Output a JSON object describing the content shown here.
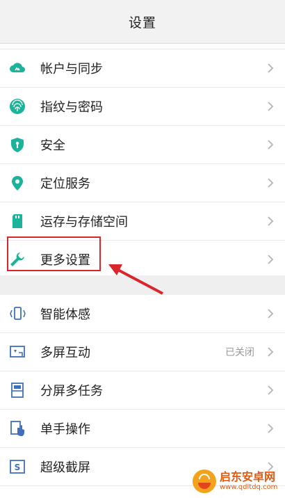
{
  "header": {
    "title": "设置"
  },
  "group1": [
    {
      "id": "account-sync",
      "label": "帐户与同步",
      "icon": "cloud-sync-icon"
    },
    {
      "id": "fingerprint-password",
      "label": "指纹与密码",
      "icon": "fingerprint-icon"
    },
    {
      "id": "security",
      "label": "安全",
      "icon": "shield-icon"
    },
    {
      "id": "location",
      "label": "定位服务",
      "icon": "location-pin-icon"
    },
    {
      "id": "storage",
      "label": "运存与存储空间",
      "icon": "sd-card-icon"
    },
    {
      "id": "more-settings",
      "label": "更多设置",
      "icon": "wrench-icon"
    }
  ],
  "group2": [
    {
      "id": "smart-motion",
      "label": "智能体感",
      "icon": "phone-motion-icon"
    },
    {
      "id": "multi-screen",
      "label": "多屏互动",
      "value": "已关闭",
      "icon": "cast-screen-icon"
    },
    {
      "id": "split-screen",
      "label": "分屏多任务",
      "icon": "split-screen-icon"
    },
    {
      "id": "one-hand",
      "label": "单手操作",
      "icon": "one-hand-icon"
    },
    {
      "id": "super-screenshot",
      "label": "超级截屏",
      "icon": "screenshot-icon"
    }
  ],
  "watermark": {
    "brand": "启东安卓网",
    "site": "www.qdltdq.com"
  },
  "colors": {
    "icon_teal": "#1bb39a",
    "icon_blue": "#3f6fb8",
    "highlight_red": "#d8262c"
  }
}
